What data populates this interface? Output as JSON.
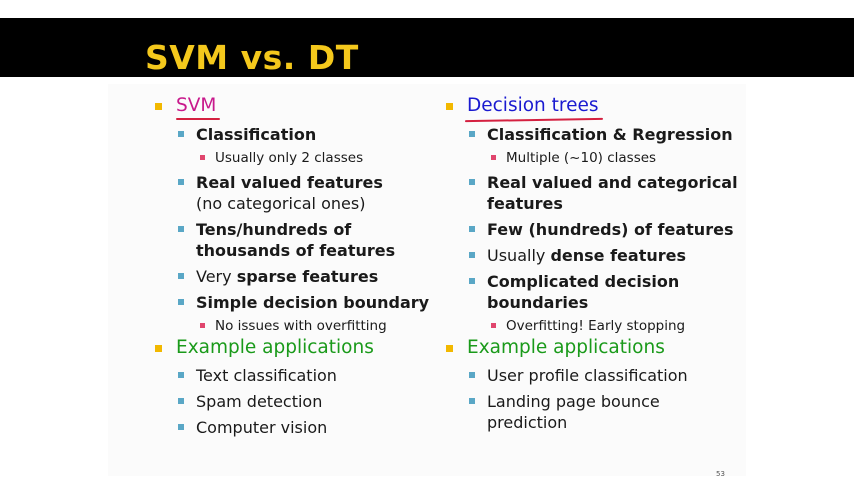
{
  "title": "SVM vs. DT",
  "left": {
    "heading": "SVM",
    "points": [
      {
        "label": "Classification",
        "sub": "Usually only 2 classes"
      },
      {
        "label": "Real valued features",
        "extra": "(no categorical ones)"
      },
      {
        "label": "Tens/hundreds of",
        "label2": "thousands of features"
      },
      {
        "prefix": "Very ",
        "label": "sparse features"
      },
      {
        "label": "Simple decision boundary",
        "sub": "No issues with overfitting"
      }
    ],
    "apps_heading": "Example applications",
    "apps": [
      "Text classification",
      "Spam detection",
      "Computer vision"
    ]
  },
  "right": {
    "heading": "Decision trees",
    "points": [
      {
        "label": "Classification & Regression",
        "sub": "Multiple (~10) classes"
      },
      {
        "label": "Real valued and categorical",
        "label2": "features"
      },
      {
        "label": "Few (hundreds) of features"
      },
      {
        "prefix": "Usually ",
        "label": "dense features"
      },
      {
        "label": "Complicated decision",
        "label2": "boundaries",
        "sub": "Overfitting! Early stopping"
      }
    ],
    "apps_heading": "Example applications",
    "apps": [
      "User profile classification",
      "Landing page bounce",
      "prediction"
    ]
  },
  "page_number": "53",
  "colors": {
    "title": "#f4c81c",
    "svm_heading": "#c8198c",
    "dt_heading": "#1a1ad0",
    "apps_heading": "#1a9a1a",
    "bullet_l1": "#f2b800",
    "bullet_l2": "#5aa7c6",
    "bullet_l3": "#e0456d"
  }
}
